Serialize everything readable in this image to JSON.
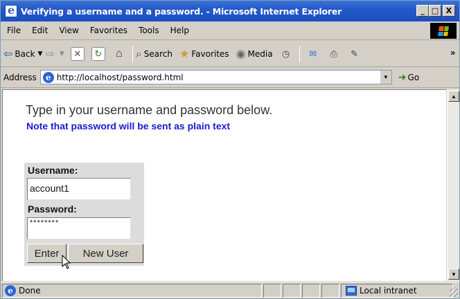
{
  "window": {
    "title": "Verifying a username and a password. - Microsoft Internet Explorer",
    "controls": {
      "minimize": "_",
      "maximize": "□",
      "close": "X"
    }
  },
  "menubar": {
    "items": [
      "File",
      "Edit",
      "View",
      "Favorites",
      "Tools",
      "Help"
    ]
  },
  "toolbar": {
    "back_label": "Back",
    "search_label": "Search",
    "favorites_label": "Favorites",
    "media_label": "Media",
    "more": "»"
  },
  "address": {
    "label": "Address",
    "url": "http://localhost/password.html",
    "go_label": "Go"
  },
  "page": {
    "prompt": "Type in your username and password below.",
    "note": "Note that password will be sent as plain text",
    "colors": {
      "note": "#1a1ad6"
    },
    "form": {
      "username_label": "Username:",
      "username_value": "account1",
      "password_label": "Password:",
      "password_value": "********",
      "enter_label": "Enter",
      "new_user_label": "New User"
    }
  },
  "statusbar": {
    "status": "Done",
    "zone": "Local intranet"
  }
}
